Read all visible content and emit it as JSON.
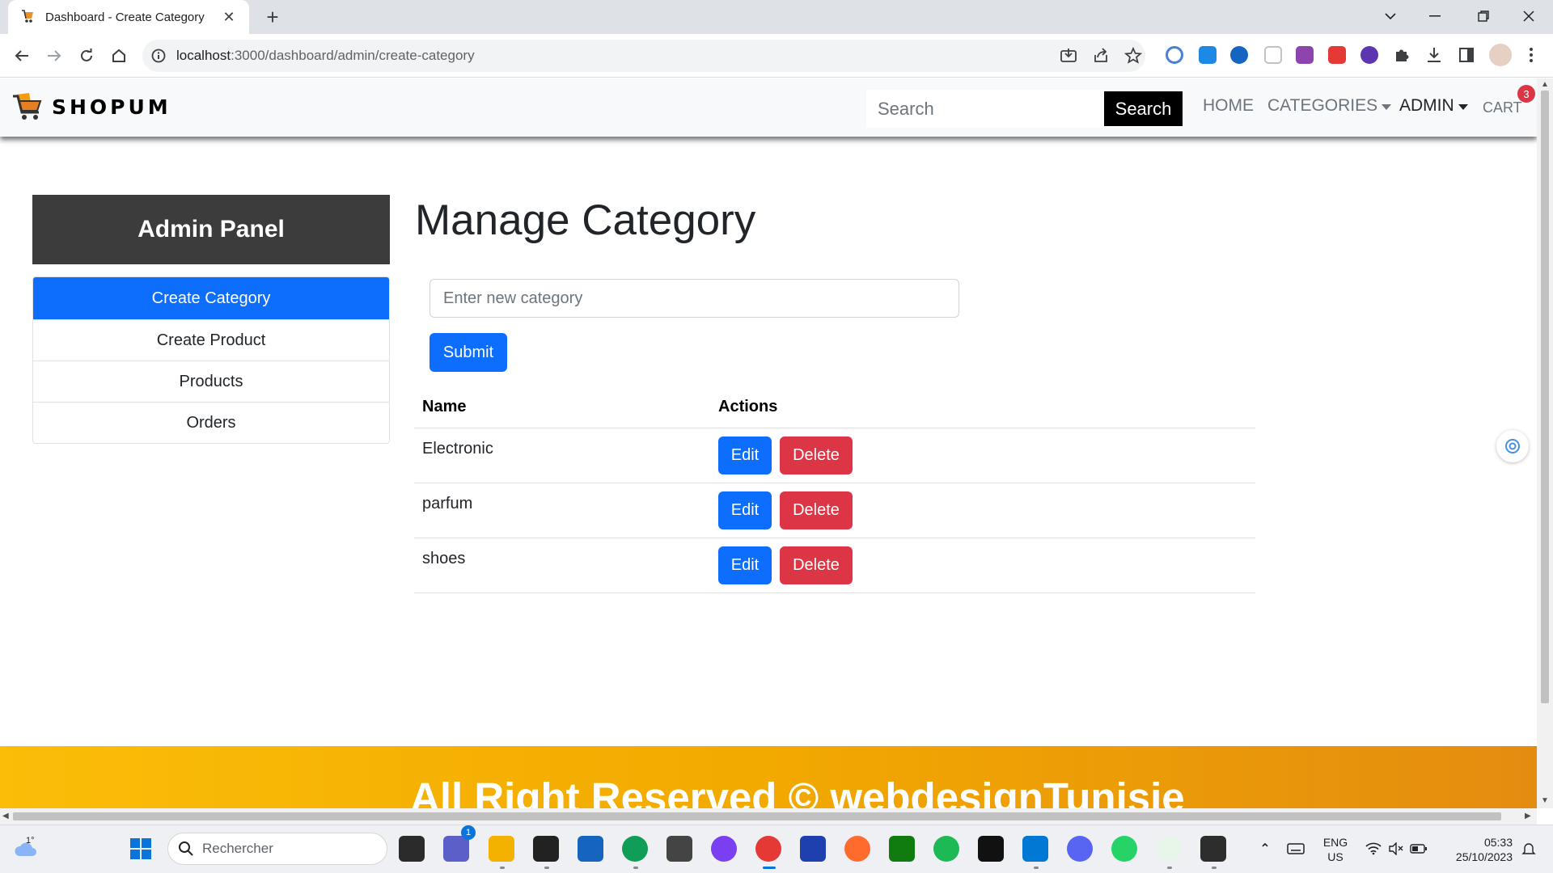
{
  "browser": {
    "tab_title": "Dashboard - Create Category",
    "url_host": "localhost",
    "url_rest": ":3000/dashboard/admin/create-category"
  },
  "site": {
    "brand": "SHOPUM",
    "search_placeholder": "Search",
    "search_button": "Search",
    "nav": {
      "home": "HOME",
      "categories": "CATEGORIES",
      "admin": "ADMIN",
      "cart": "CART",
      "cart_count": "3"
    }
  },
  "admin_panel": {
    "title": "Admin Panel",
    "menu": [
      {
        "label": "Create Category",
        "active": true
      },
      {
        "label": "Create Product",
        "active": false
      },
      {
        "label": "Products",
        "active": false
      },
      {
        "label": "Orders",
        "active": false
      }
    ]
  },
  "main": {
    "title": "Manage Category",
    "input_placeholder": "Enter new category",
    "submit_label": "Submit",
    "table": {
      "headers": [
        "Name",
        "Actions"
      ],
      "rows": [
        {
          "name": "Electronic"
        },
        {
          "name": "parfum"
        },
        {
          "name": "shoes"
        }
      ],
      "edit_label": "Edit",
      "delete_label": "Delete"
    }
  },
  "footer": {
    "text": "All Right Reserved © webdesignTunisie"
  },
  "taskbar": {
    "weather": "1°",
    "search_placeholder": "Rechercher",
    "teams_badge": "1",
    "lang_top": "ENG",
    "lang_bottom": "US",
    "time": "05:33",
    "date": "25/10/2023"
  },
  "colors": {
    "primary": "#0d6efd",
    "danger": "#dc3545",
    "admin_header": "#3c3c3c",
    "footer_start": "#fbbd08",
    "footer_end": "#e48c10"
  }
}
